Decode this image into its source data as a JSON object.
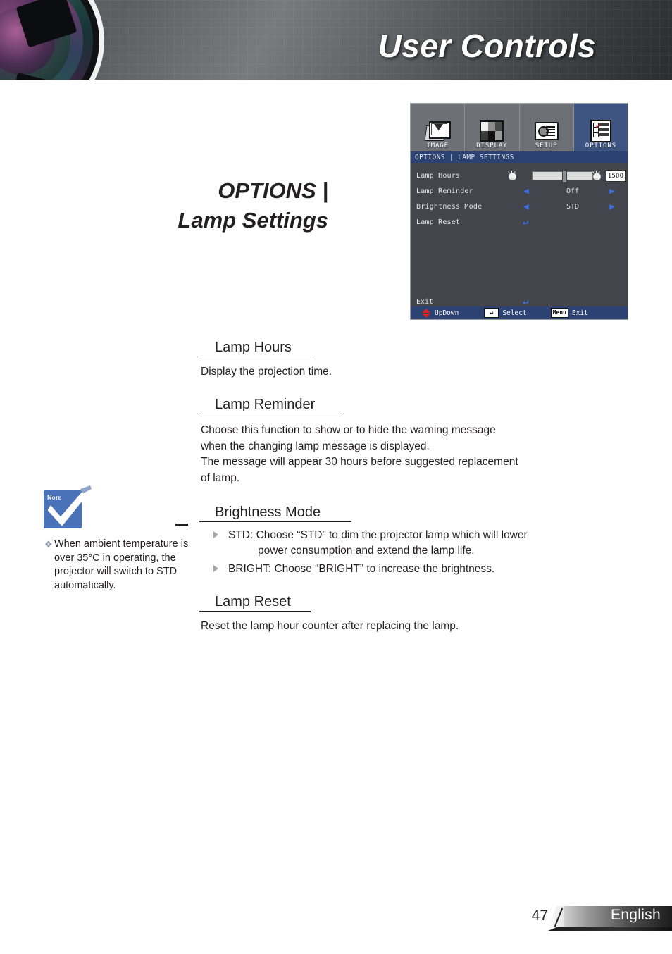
{
  "header": {
    "title": "User Controls",
    "lens_icon": "projector-lens-graphic"
  },
  "page_title": {
    "line1": "OPTIONS |",
    "line2": "Lamp Settings"
  },
  "osd": {
    "tabs": [
      {
        "label": "IMAGE",
        "icon": "image-icon",
        "active": false
      },
      {
        "label": "DISPLAY",
        "icon": "display-icon",
        "active": false
      },
      {
        "label": "SETUP",
        "icon": "setup-icon",
        "active": false
      },
      {
        "label": "OPTIONS",
        "icon": "options-icon",
        "active": true
      }
    ],
    "titlebar": "OPTIONS | LAMP SETTINGS",
    "rows": {
      "lamp_hours": {
        "label": "Lamp Hours",
        "value": "1500",
        "slider_percent": 52
      },
      "lamp_reminder": {
        "label": "Lamp Reminder",
        "value": "Off",
        "left_arrow": "◀",
        "right_arrow": "▶"
      },
      "brightness_mode": {
        "label": "Brightness Mode",
        "value": "STD",
        "left_arrow": "◀",
        "right_arrow": "▶"
      },
      "lamp_reset": {
        "label": "Lamp Reset",
        "enter_glyph": "↵"
      }
    },
    "exit": {
      "label": "Exit",
      "enter_glyph": "↵"
    },
    "statusbar": {
      "updown": "UpDown",
      "select": "Select",
      "select_key": "↵",
      "exit": "Exit",
      "exit_key": "Menu"
    },
    "colors": {
      "body_bg": "#44454c",
      "titlebar_bg": "#2c4272",
      "tab_bg": "#6e7078",
      "tab_active_bg": "#3e5582",
      "arrow_blue": "#3c6ee0",
      "updown_red": "#e02020"
    }
  },
  "note": {
    "badge_label": "Note",
    "bullet": "❖",
    "text": "When ambient temperature is over 35°C in operating, the projector will switch to STD automatically.",
    "badge_color": "#4a72b8"
  },
  "sections": [
    {
      "heading": "Lamp Hours",
      "body": "Display the projection time."
    },
    {
      "heading": "Lamp Reminder",
      "body_line1": "Choose this function to show or to hide the warning message",
      "body_line2": "when the changing lamp message is displayed.",
      "body_line3": "The message will appear 30 hours before suggested replacement",
      "body_line4": "of lamp."
    },
    {
      "heading": "Brightness Mode",
      "bullets": [
        {
          "line1": "STD: Choose “STD” to dim the projector lamp which will lower",
          "line2": "power consumption and extend the lamp life."
        },
        {
          "line1": "BRIGHT: Choose “BRIGHT” to increase the brightness."
        }
      ]
    },
    {
      "heading": "Lamp Reset",
      "body": "Reset the lamp hour counter after replacing the lamp."
    }
  ],
  "footer": {
    "page_number": "47",
    "language": "English"
  }
}
